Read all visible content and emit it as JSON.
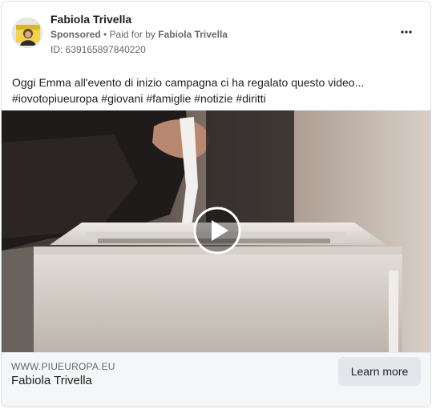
{
  "ad": {
    "page_name": "Fabiola Trivella",
    "sponsored_label": "Sponsored",
    "separator": " • ",
    "paid_for_prefix": "Paid for by ",
    "paid_for_name": "Fabiola Trivella",
    "ad_id": "ID: 639165897840220",
    "more_icon": "more-horizontal-icon",
    "body_line1": "Oggi Emma all'evento di inizio campagna ci ha regalato questo video...",
    "body_line2": "#iovotopiueuropa #giovani #famiglie #notizie #diritti"
  },
  "media": {
    "type": "video",
    "play_icon": "play-icon"
  },
  "footer": {
    "domain": "WWW.PIUEUROPA.EU",
    "headline": "Fabiola Trivella",
    "cta_label": "Learn more"
  },
  "colors": {
    "border": "#dadde1",
    "secondary_text": "#65676b",
    "footer_bg": "#f5f6f7",
    "cta_bg": "#e4e6eb"
  }
}
